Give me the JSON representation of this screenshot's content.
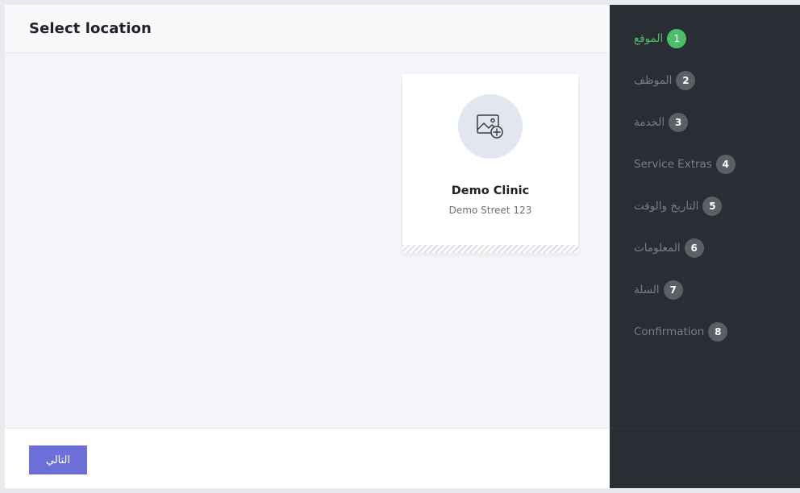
{
  "header": {
    "title": "Select location"
  },
  "card": {
    "title": "Demo Clinic",
    "subtitle": "Demo Street 123",
    "icon": "image-add-icon"
  },
  "footer": {
    "next_label": "التالي"
  },
  "steps": [
    {
      "label": "الموقع",
      "number": "1",
      "active": true
    },
    {
      "label": "الموظف",
      "number": "2"
    },
    {
      "label": "الخدمة",
      "number": "3"
    },
    {
      "label": "Service Extras",
      "number": "4"
    },
    {
      "label": "التاريخ والوقت",
      "number": "5"
    },
    {
      "label": "المعلومات",
      "number": "6"
    },
    {
      "label": "السلة",
      "number": "7"
    },
    {
      "label": "Confirmation",
      "number": "8"
    }
  ],
  "colors": {
    "accent": "#6c6fd8",
    "active_step": "#4cbe6a",
    "sidebar": "#2a2d33"
  }
}
